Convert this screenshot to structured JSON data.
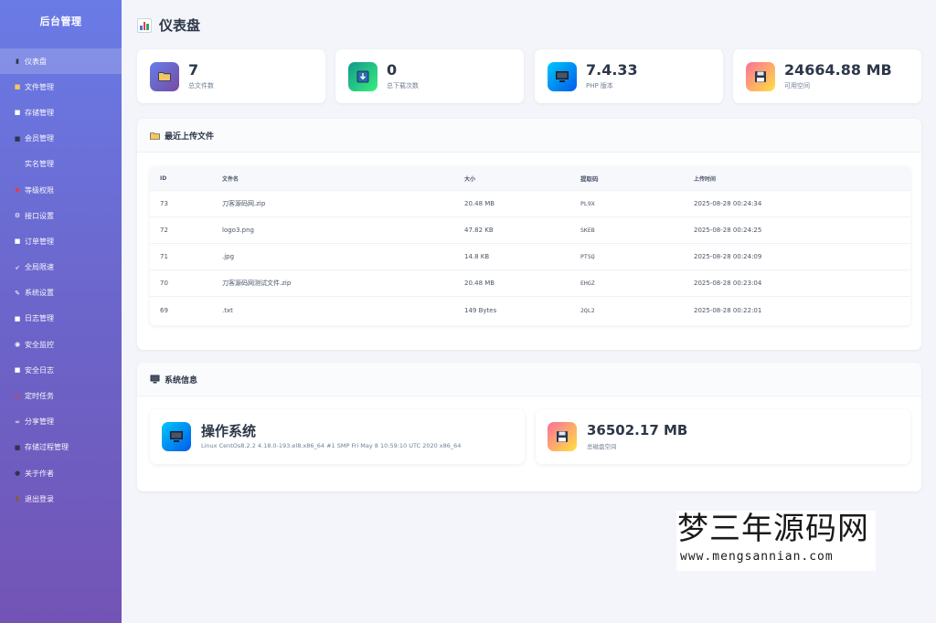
{
  "sidebar": {
    "brand": "后台管理",
    "items": [
      {
        "icon": "bar-chart-icon",
        "glyph": "▮",
        "glyph_color": "#2d3748",
        "label": "仪表盘"
      },
      {
        "icon": "folder-icon",
        "glyph": "■",
        "glyph_color": "#f6c760",
        "label": "文件管理"
      },
      {
        "icon": "storage-icon",
        "glyph": "■",
        "glyph_color": "#ffffff",
        "label": "存储管理"
      },
      {
        "icon": "members-icon",
        "glyph": "■",
        "glyph_color": "#2d3748",
        "label": "会员管理"
      },
      {
        "icon": "check-icon",
        "glyph": "✓",
        "glyph_color": "#38a169",
        "label": "实名管理"
      },
      {
        "icon": "shield-icon",
        "glyph": "◆",
        "glyph_color": "#e53e3e",
        "label": "等级权限"
      },
      {
        "icon": "gear-icon",
        "glyph": "⚙",
        "glyph_color": "#ffffff",
        "label": "接口设置"
      },
      {
        "icon": "order-icon",
        "glyph": "■",
        "glyph_color": "#ffffff",
        "label": "订单管理"
      },
      {
        "icon": "rocket-icon",
        "glyph": "➶",
        "glyph_color": "#ffffff",
        "label": "全局限速"
      },
      {
        "icon": "pencil-icon",
        "glyph": "✎",
        "glyph_color": "#ffffff",
        "label": "系统设置"
      },
      {
        "icon": "log-icon",
        "glyph": "■",
        "glyph_color": "#ffffff",
        "label": "日志管理"
      },
      {
        "icon": "eye-icon",
        "glyph": "◉",
        "glyph_color": "#ffffff",
        "label": "安全监控"
      },
      {
        "icon": "document-icon",
        "glyph": "■",
        "glyph_color": "#ffffff",
        "label": "安全日志"
      },
      {
        "icon": "alarm-clock-icon",
        "glyph": "◷",
        "glyph_color": "#e53e3e",
        "label": "定时任务"
      },
      {
        "icon": "link-icon",
        "glyph": "∞",
        "glyph_color": "#ffffff",
        "label": "分享管理"
      },
      {
        "icon": "computer-icon",
        "glyph": "■",
        "glyph_color": "#2d3748",
        "label": "存储过程管理"
      },
      {
        "icon": "author-icon",
        "glyph": "●",
        "glyph_color": "#2d3748",
        "label": "关于作者"
      },
      {
        "icon": "door-icon",
        "glyph": "▮",
        "glyph_color": "#8b5a2b",
        "label": "退出登录"
      }
    ]
  },
  "page": {
    "title": "仪表盘",
    "title_icon": "bar-chart-icon"
  },
  "stats": [
    {
      "icon": "folder-icon",
      "value": "7",
      "label": "总文件数",
      "gradient": [
        "#667eea",
        "#764ba2"
      ]
    },
    {
      "icon": "download-icon",
      "value": "0",
      "label": "总下载次数",
      "gradient": [
        "#11998e",
        "#38ef7d"
      ]
    },
    {
      "icon": "monitor-icon",
      "value": "7.4.33",
      "label": "PHP 版本",
      "gradient": [
        "#00c6fb",
        "#005bea"
      ]
    },
    {
      "icon": "floppy-disk-icon",
      "value": "24664.88 MB",
      "label": "可用空间",
      "gradient": [
        "#fa709a",
        "#fee140"
      ]
    }
  ],
  "recent_files": {
    "title": "最近上传文件",
    "icon": "folder-icon",
    "columns": [
      "ID",
      "文件名",
      "大小",
      "提取码",
      "上传时间"
    ],
    "rows": [
      [
        "73",
        "刀客源码网.zip",
        "20.48 MB",
        "PL9X",
        "2025-08-28 00:24:34"
      ],
      [
        "72",
        "logo3.png",
        "47.82 KB",
        "SKEB",
        "2025-08-28 00:24:25"
      ],
      [
        "71",
        ".jpg",
        "14.8 KB",
        "PTSQ",
        "2025-08-28 00:24:09"
      ],
      [
        "70",
        "刀客源码网测试文件.zip",
        "20.48 MB",
        "EHGZ",
        "2025-08-28 00:23:04"
      ],
      [
        "69",
        ".txt",
        "149 Bytes",
        "2QL2",
        "2025-08-28 00:22:01"
      ]
    ]
  },
  "system_info": {
    "title": "系统信息",
    "icon": "monitor-icon",
    "os": {
      "title": "操作系统",
      "detail": "Linux CentOs8.2.2 4.18.0-193.el8.x86_64 #1 SMP Fri May 8 10:59:10 UTC 2020 x86_64"
    },
    "disk": {
      "title": "36502.17 MB",
      "detail": "总磁盘空间"
    }
  },
  "watermark": {
    "line1": "梦三年源码网",
    "line2": "www.mengsannian.com"
  }
}
